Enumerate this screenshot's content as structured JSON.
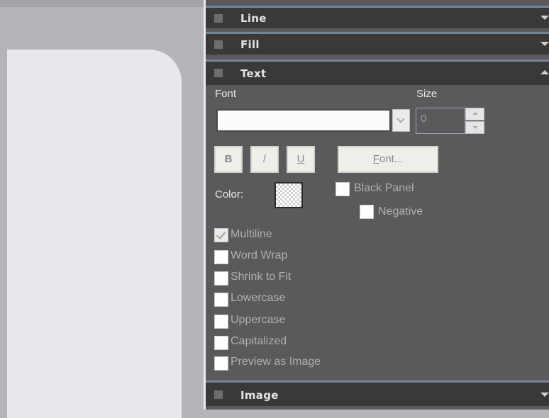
{
  "sections": {
    "line": {
      "title": "Line"
    },
    "fill": {
      "title": "Fill"
    },
    "text": {
      "title": "Text"
    },
    "image": {
      "title": "Image"
    }
  },
  "text_panel": {
    "font_label": "Font",
    "size_label": "Size",
    "font_value": "",
    "size_value": "0",
    "bold_label": "B",
    "italic_label": "/",
    "underline_label": "U",
    "font_button_prefix": "F",
    "font_button_rest": "ont...",
    "color_label": "Color:",
    "black_panel_label": "Black Panel",
    "negative_label": "Negative",
    "options": [
      {
        "label": "Multiline",
        "checked": true
      },
      {
        "label": "Word Wrap",
        "checked": false
      },
      {
        "label": "Shrink to Fit",
        "checked": false
      },
      {
        "label": "Lowercase",
        "checked": false
      },
      {
        "label": "Uppercase",
        "checked": false
      },
      {
        "label": "Capitalized",
        "checked": false
      },
      {
        "label": "Preview as Image",
        "checked": false
      }
    ]
  },
  "colors": {
    "panel_bg": "#5b595b",
    "header_bg": "#3b3839",
    "header_accent": "#6e8899",
    "canvas_bg": "#b6b4ba",
    "page_bg": "#e8e7eb"
  }
}
